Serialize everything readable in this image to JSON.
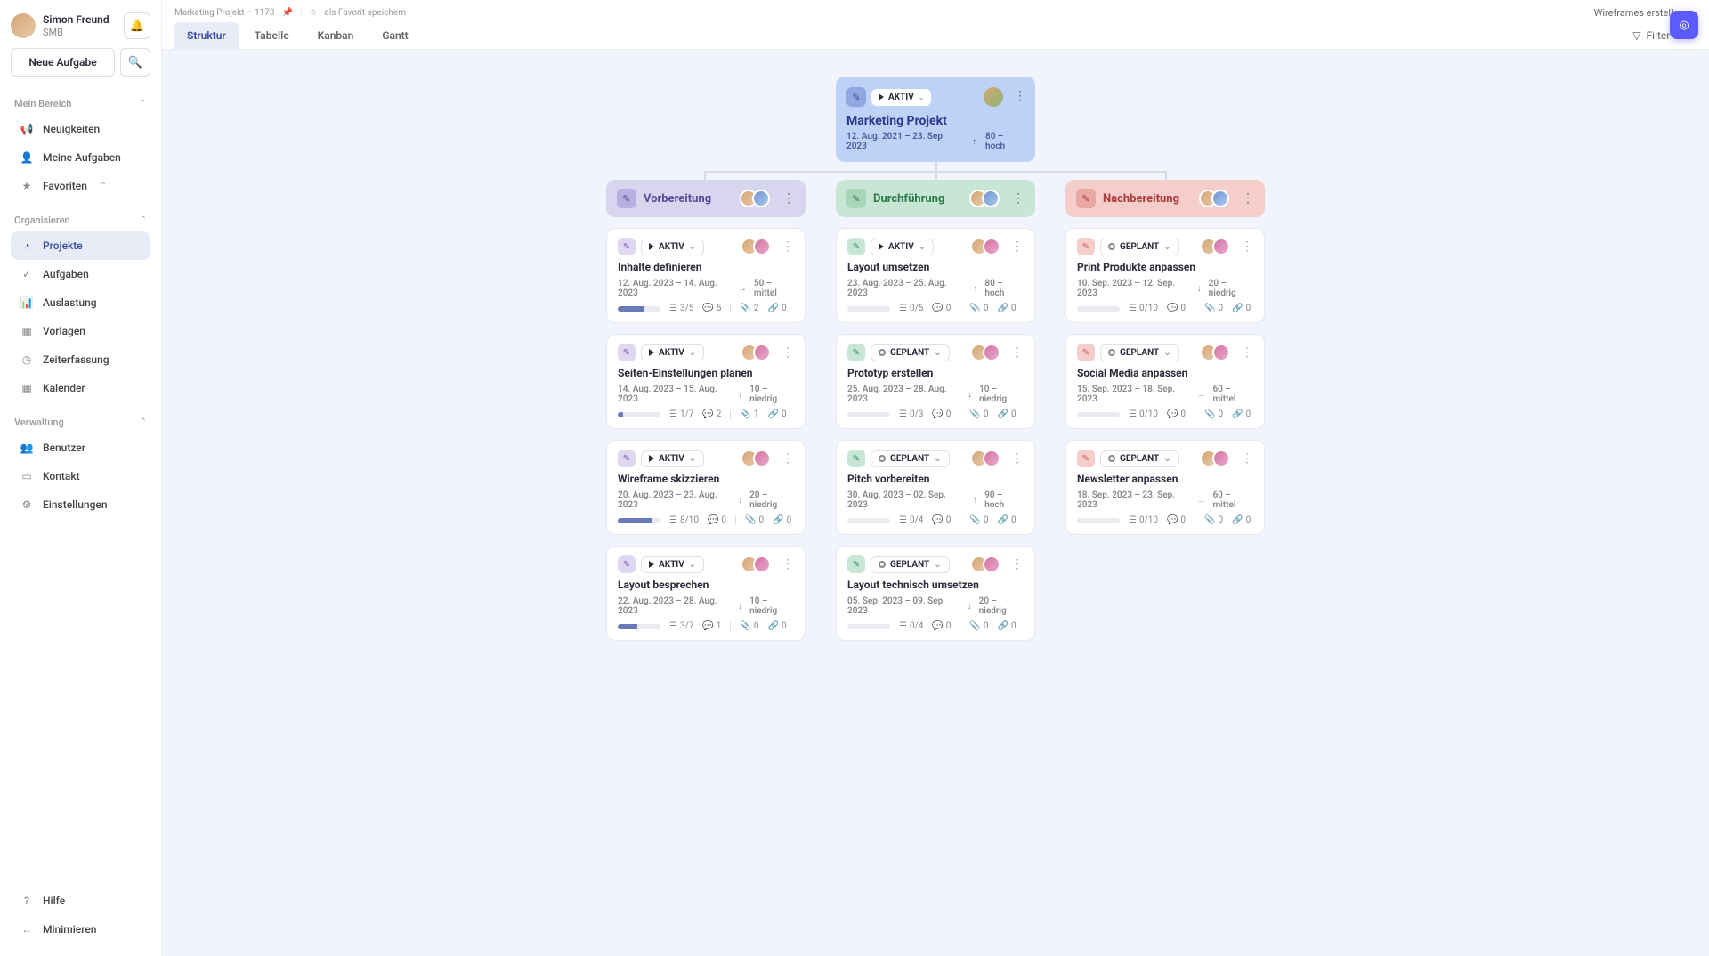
{
  "user": {
    "name": "Simon Freund",
    "sub": "SMB"
  },
  "newTask": "Neue Aufgabe",
  "sections": {
    "myArea": {
      "title": "Mein Bereich",
      "items": [
        {
          "id": "news",
          "label": "Neuigkeiten",
          "icon": "📢"
        },
        {
          "id": "tasks",
          "label": "Meine Aufgaben",
          "icon": "👤"
        },
        {
          "id": "favs",
          "label": "Favoriten",
          "icon": "★",
          "expand": true
        }
      ]
    },
    "organize": {
      "title": "Organisieren",
      "items": [
        {
          "id": "projects",
          "label": "Projekte",
          "icon": "◔",
          "active": true
        },
        {
          "id": "tasks2",
          "label": "Aufgaben",
          "icon": "✓"
        },
        {
          "id": "workload",
          "label": "Auslastung",
          "icon": "📊"
        },
        {
          "id": "templates",
          "label": "Vorlagen",
          "icon": "▦"
        },
        {
          "id": "time",
          "label": "Zeiterfassung",
          "icon": "◷"
        },
        {
          "id": "calendar",
          "label": "Kalender",
          "icon": "▦"
        }
      ]
    },
    "admin": {
      "title": "Verwaltung",
      "items": [
        {
          "id": "users",
          "label": "Benutzer",
          "icon": "👥"
        },
        {
          "id": "contact",
          "label": "Kontakt",
          "icon": "▭"
        },
        {
          "id": "settings",
          "label": "Einstellungen",
          "icon": "⚙"
        }
      ]
    }
  },
  "footer": [
    {
      "id": "help",
      "label": "Hilfe",
      "icon": "?"
    },
    {
      "id": "minimize",
      "label": "Minimieren",
      "icon": "←"
    }
  ],
  "breadcrumb": "Marketing Projekt – 1173",
  "favoriteLabel": "als Favorit speichern",
  "topDropdown": "Wireframes erstellen",
  "tabs": [
    "Struktur",
    "Tabelle",
    "Kanban",
    "Gantt"
  ],
  "activeTab": 0,
  "filterLabel": "Filter",
  "root": {
    "status": "AKTIV",
    "title": "Marketing Projekt",
    "dates": "12. Aug. 2021 – 23. Sep 2023",
    "priority": "80 – hoch"
  },
  "columns": [
    {
      "title": "Vorbereitung",
      "color": "c0",
      "tasks": [
        {
          "badge": "purple",
          "status": "AKTIV",
          "play": true,
          "title": "Inhalte definieren",
          "dates": "12. Aug. 2023 – 14. Aug. 2023",
          "arrow": "→",
          "prio": "50 – mittel",
          "progPct": 60,
          "checklist": "3/5",
          "comments": "5",
          "attach": "2",
          "links": "0"
        },
        {
          "badge": "purple",
          "status": "AKTIV",
          "play": true,
          "title": "Seiten-Einstellungen planen",
          "dates": "14. Aug. 2023 – 15. Aug. 2023",
          "arrow": "↓",
          "prio": "10 – niedrig",
          "progPct": 12,
          "checklist": "1/7",
          "comments": "2",
          "attach": "1",
          "links": "0"
        },
        {
          "badge": "purple",
          "status": "AKTIV",
          "play": true,
          "title": "Wireframe skizzieren",
          "dates": "20. Aug. 2023 – 23. Aug. 2023",
          "arrow": "↓",
          "prio": "20 – niedrig",
          "progPct": 80,
          "checklist": "8/10",
          "comments": "0",
          "attach": "0",
          "links": "0"
        },
        {
          "badge": "purple",
          "status": "AKTIV",
          "play": true,
          "title": "Layout besprechen",
          "dates": "22. Aug. 2023 – 28. Aug. 2023",
          "arrow": "↓",
          "prio": "10 – niedrig",
          "progPct": 45,
          "checklist": "3/7",
          "comments": "1",
          "attach": "0",
          "links": "0"
        }
      ]
    },
    {
      "title": "Durchführung",
      "color": "c1",
      "tasks": [
        {
          "badge": "green",
          "status": "AKTIV",
          "play": true,
          "title": "Layout umsetzen",
          "dates": "23. Aug. 2023 – 25. Aug. 2023",
          "arrow": "↑",
          "prio": "80 – hoch",
          "progPct": 0,
          "checklist": "0/5",
          "comments": "0",
          "attach": "0",
          "links": "0"
        },
        {
          "badge": "green",
          "status": "GEPLANT",
          "play": false,
          "title": "Prototyp erstellen",
          "dates": "25. Aug. 2023 – 28. Aug. 2023",
          "arrow": "↓",
          "prio": "10 – niedrig",
          "progPct": 0,
          "checklist": "0/3",
          "comments": "0",
          "attach": "0",
          "links": "0"
        },
        {
          "badge": "green",
          "status": "GEPLANT",
          "play": false,
          "title": "Pitch vorbereiten",
          "dates": "30. Aug. 2023 – 02. Sep. 2023",
          "arrow": "↑",
          "prio": "90 – hoch",
          "progPct": 0,
          "checklist": "0/4",
          "comments": "0",
          "attach": "0",
          "links": "0"
        },
        {
          "badge": "green",
          "status": "GEPLANT",
          "play": false,
          "title": "Layout technisch umsetzen",
          "dates": "05. Sep. 2023 – 09. Sep. 2023",
          "arrow": "↓",
          "prio": "20 – niedrig",
          "progPct": 0,
          "checklist": "0/4",
          "comments": "0",
          "attach": "0",
          "links": "0"
        }
      ]
    },
    {
      "title": "Nachbereitung",
      "color": "c2",
      "tasks": [
        {
          "badge": "red",
          "status": "GEPLANT",
          "play": false,
          "title": "Print Produkte anpassen",
          "dates": "10. Sep. 2023 – 12. Sep. 2023",
          "arrow": "↓",
          "prio": "20 – niedrig",
          "progPct": 0,
          "checklist": "0/10",
          "comments": "0",
          "attach": "0",
          "links": "0"
        },
        {
          "badge": "red",
          "status": "GEPLANT",
          "play": false,
          "title": "Social Media anpassen",
          "dates": "15. Sep. 2023 – 18. Sep. 2023",
          "arrow": "→",
          "prio": "60 – mittel",
          "progPct": 0,
          "checklist": "0/10",
          "comments": "0",
          "attach": "0",
          "links": "0"
        },
        {
          "badge": "red",
          "status": "GEPLANT",
          "play": false,
          "title": "Newsletter anpassen",
          "dates": "18. Sep. 2023 – 23. Sep. 2023",
          "arrow": "→",
          "prio": "60 – mittel",
          "progPct": 0,
          "checklist": "0/10",
          "comments": "0",
          "attach": "0",
          "links": "0"
        }
      ]
    }
  ]
}
